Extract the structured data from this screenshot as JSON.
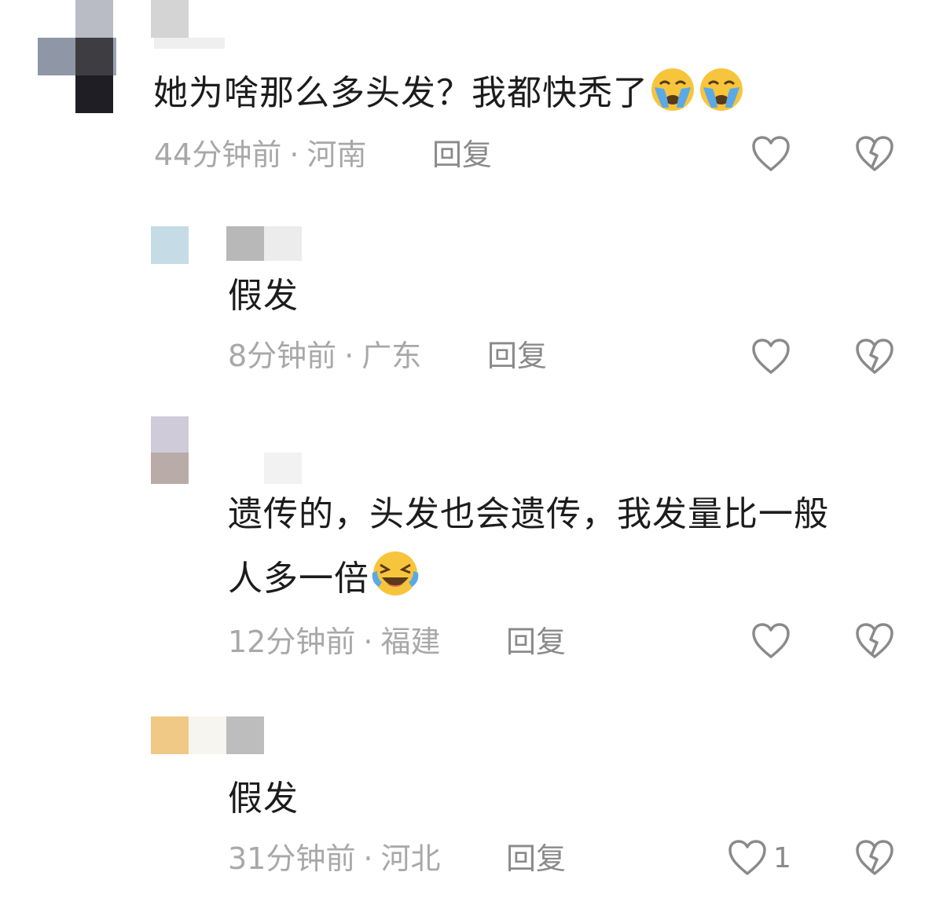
{
  "comments": [
    {
      "text": "她为啥那么多头发？我都快秃了",
      "emoji": "crying-emoji",
      "emoji_count": 2,
      "time": "44分钟前",
      "location": "河南",
      "reply_label": "回复"
    },
    {
      "text": "假发",
      "time": "8分钟前",
      "location": "广东",
      "reply_label": "回复"
    },
    {
      "text_line1": "遗传的，头发也会遗传，我发量比一般",
      "text_line2": "人多一倍",
      "emoji": "laughing-tears-emoji",
      "time": "12分钟前",
      "location": "福建",
      "reply_label": "回复"
    },
    {
      "text": "假发",
      "time": "31分钟前",
      "location": "河北",
      "reply_label": "回复",
      "like_count": "1"
    }
  ],
  "colors": {
    "text": "#1c1c1c",
    "meta": "#a8a8a8",
    "icon": "#8a8a8a",
    "emoji_yellow": "#f7c53c",
    "emoji_tear": "#5aa9e6"
  }
}
